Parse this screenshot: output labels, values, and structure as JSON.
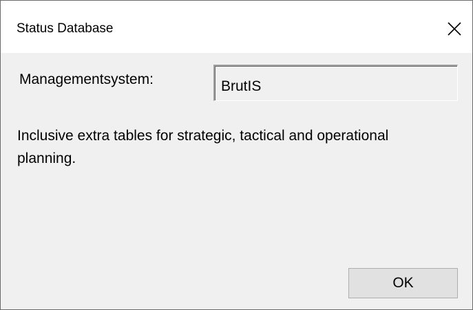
{
  "window": {
    "title": "Status Database",
    "close_icon": "close-icon"
  },
  "form": {
    "management_label": "Managementsystem:",
    "management_value": "BrutIS",
    "description": "Inclusive extra tables for strategic, tactical and operational planning."
  },
  "actions": {
    "ok_label": "OK"
  }
}
